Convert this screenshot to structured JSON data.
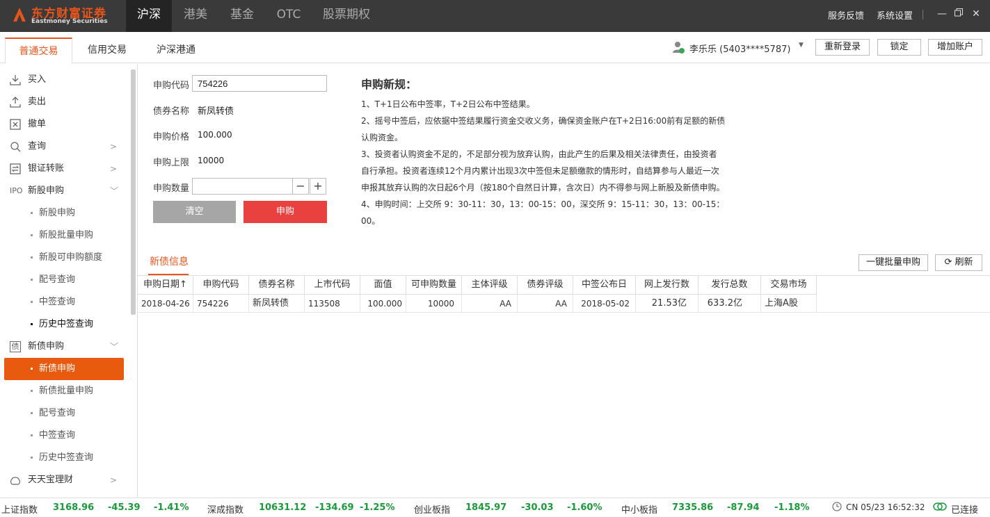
{
  "app": {
    "logo_cn": "东方财富证券",
    "logo_en": "Eastmoney Securities"
  },
  "main_tabs": [
    "沪深",
    "港美",
    "基金",
    "OTC",
    "股票期权"
  ],
  "top_links": {
    "feedback": "服务反馈",
    "settings": "系统设置"
  },
  "sub_tabs": [
    "普通交易",
    "信用交易",
    "沪深港通"
  ],
  "user": {
    "name": "李乐乐 (5403****5787)"
  },
  "header_buttons": {
    "relogin": "重新登录",
    "lock": "锁定",
    "add_account": "增加账户"
  },
  "sidebar": {
    "items": [
      {
        "label": "买入",
        "icon": "download-icon"
      },
      {
        "label": "卖出",
        "icon": "upload-icon"
      },
      {
        "label": "撤单",
        "icon": "cancel-box-icon"
      },
      {
        "label": "查询",
        "icon": "search-icon"
      },
      {
        "label": "银证转账",
        "icon": "transfer-icon"
      },
      {
        "label": "新股申购",
        "icon": "ipo-icon",
        "icon_text": "IPO"
      },
      {
        "label": "新债申购",
        "icon": "bond-icon",
        "icon_text": "债"
      },
      {
        "label": "天天宝理财",
        "icon": "wealth-icon"
      }
    ],
    "ipo_sub": [
      "新股申购",
      "新股批量申购",
      "新股可申购额度",
      "配号查询",
      "中签查询",
      "历史中签查询"
    ],
    "bond_sub": [
      "新债申购",
      "新债批量申购",
      "配号查询",
      "中签查询",
      "历史中签查询"
    ]
  },
  "form": {
    "code_label": "申购代码",
    "code_value": "754226",
    "name_label": "债券名称",
    "name_value": "新凤转债",
    "price_label": "申购价格",
    "price_value": "100.000",
    "limit_label": "申购上限",
    "limit_value": "10000",
    "qty_label": "申购数量",
    "qty_value": "",
    "minus": "−",
    "plus": "+",
    "clear_label": "清空",
    "submit_label": "申购"
  },
  "rules": {
    "title": "申购新规：",
    "lines": [
      "1、T+1日公布中签率，T+2日公布中签结果。",
      "2、摇号中签后，应依据中签结果履行资金交收义务，确保资金账户在T+2日16:00前有足额的新债",
      "认购资金。",
      "3、投资者认购资金不足的，不足部分视为放弃认购，由此产生的后果及相关法律责任，由投资者",
      "自行承担。投资者连续12个月内累计出现3次中签但未足额缴款的情形时，自结算参与人最近一次",
      "申报其放弃认购的次日起6个月（按180个自然日计算，含次日）内不得参与网上新股及新债申购。",
      "4、申购时间：上交所 9：30-11：30，13：00-15：00，深交所 9：15-11：30，13：00-15：00。"
    ]
  },
  "bond_info": {
    "tab_label": "新债信息",
    "batch_button": "一键批量申购",
    "refresh_button": "刷新",
    "columns": [
      "申购日期↑",
      "申购代码",
      "债券名称",
      "上市代码",
      "面值",
      "可申购数量",
      "主体评级",
      "债券评级",
      "中签公布日",
      "网上发行数",
      "发行总数",
      "交易市场"
    ],
    "rows": [
      [
        "2018-04-26",
        "754226",
        "新凤转债",
        "113508",
        "100.000",
        "10000",
        "AA",
        "AA",
        "2018-05-02",
        "21.53亿",
        "633.2亿",
        "上海A股"
      ]
    ]
  },
  "status": {
    "indices": [
      {
        "name": "上证指数",
        "value": "3168.96",
        "change": "-45.39",
        "pct": "-1.41%"
      },
      {
        "name": "深成指数",
        "value": "10631.12",
        "change": "-134.69",
        "pct": "-1.25%"
      },
      {
        "name": "创业板指",
        "value": "1845.97",
        "change": "-30.03",
        "pct": "-1.60%"
      },
      {
        "name": "中小板指",
        "value": "7335.86",
        "change": "-87.94",
        "pct": "-1.18%"
      }
    ],
    "clock": "CN 05/23 16:52:32",
    "connection": "已连接",
    "down_color": "#1a9a3a"
  }
}
